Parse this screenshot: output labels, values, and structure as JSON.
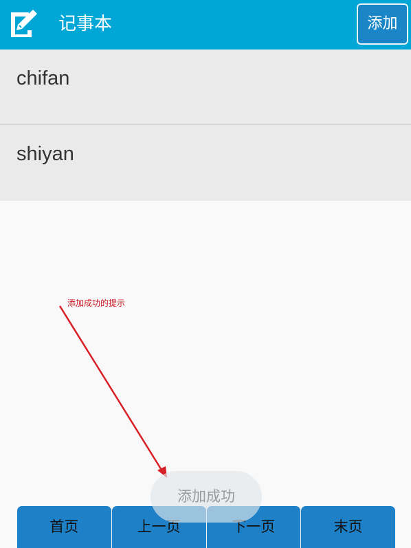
{
  "header": {
    "title": "记事本",
    "add_label": "添加",
    "icon": "note-pencil-icon",
    "background_color": "#00a7d6"
  },
  "notes": [
    {
      "title": "chifan"
    },
    {
      "title": "shiyan"
    }
  ],
  "annotation": {
    "text": "添加成功的提示",
    "color": "#c9171f"
  },
  "toast": {
    "text": "添加成功"
  },
  "pager": {
    "first": "首页",
    "prev": "上一页",
    "next": "下一页",
    "last": "末页",
    "color": "#1e80c6"
  }
}
